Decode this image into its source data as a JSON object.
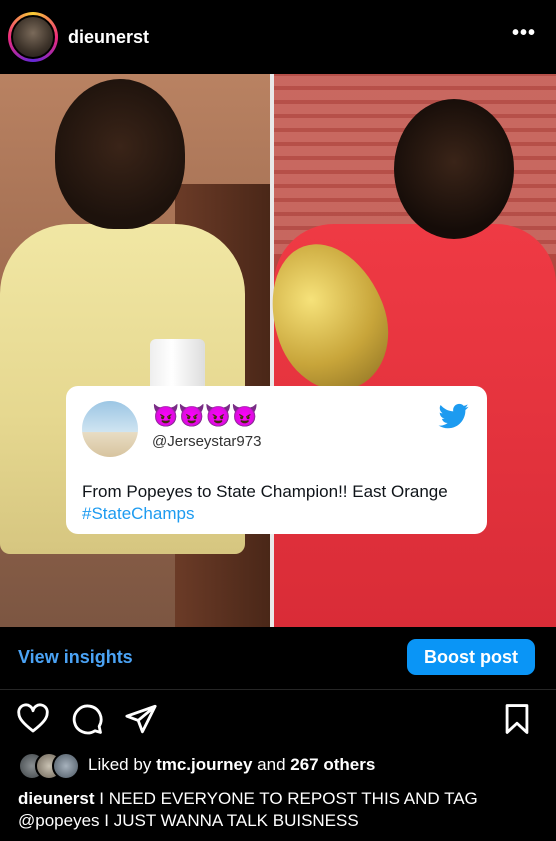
{
  "header": {
    "username": "dieunerst",
    "more_label": "•••"
  },
  "tweet": {
    "emojis": "😈😈😈😈",
    "handle": "@Jerseystar973",
    "text": "From Popeyes to State Champion!! East Orange",
    "hashtag": "#StateChamps",
    "brand_color": "#1d9bf0"
  },
  "actions": {
    "view_insights": "View insights",
    "boost_post": "Boost post",
    "boost_color": "#0a95f6"
  },
  "likes": {
    "prefix": "Liked by",
    "user": "tmc.journey",
    "middle": "and",
    "others": "267 others"
  },
  "caption": {
    "username": "dieunerst",
    "text": "I NEED EVERYONE TO REPOST THIS AND TAG",
    "mention": "@popeyes",
    "text2": "I JUST WANNA TALK BUISNESS"
  },
  "icons": [
    "heart-icon",
    "comment-icon",
    "share-icon",
    "bookmark-icon",
    "more-icon",
    "twitter-icon"
  ]
}
